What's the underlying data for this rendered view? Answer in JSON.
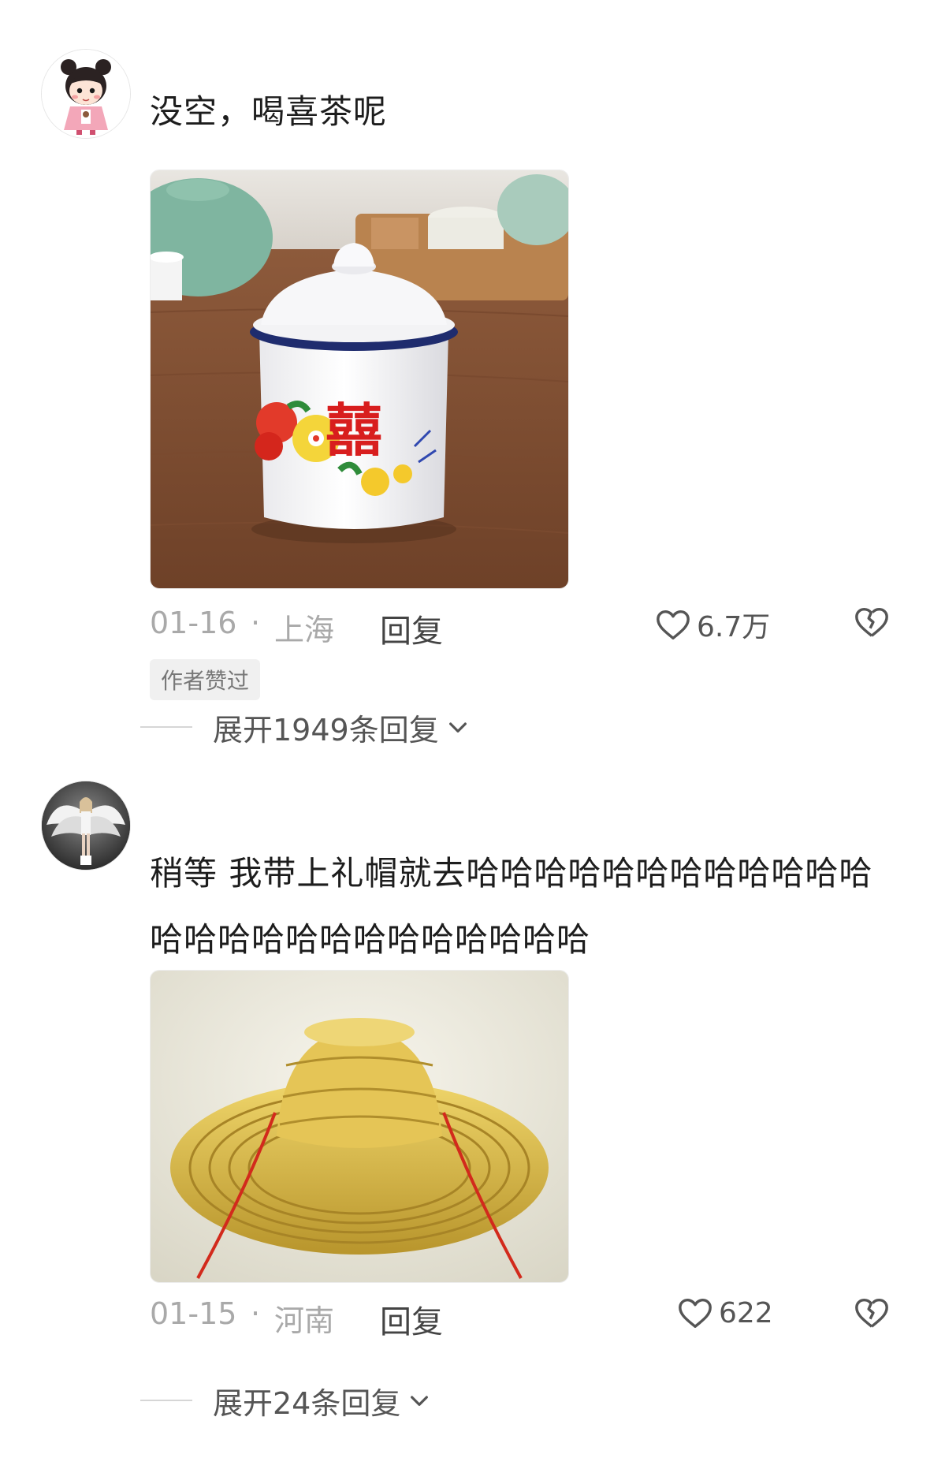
{
  "comments": [
    {
      "text": "没空，喝喜茶呢",
      "date": "01-16",
      "separator": "·",
      "location": "上海",
      "reply_label": "回复",
      "likes": "6.7万",
      "author_tag": "作者赞过",
      "expand_label": "展开1949条回复"
    },
    {
      "text": "稍等 我带上礼帽就去哈哈哈哈哈哈哈哈哈哈哈哈哈哈哈哈哈哈哈哈哈哈哈哈哈",
      "date": "01-15",
      "separator": "·",
      "location": "河南",
      "reply_label": "回复",
      "likes": "622",
      "expand_label": "展开24条回复"
    }
  ],
  "icons": {
    "like": "heart-outline-icon",
    "dislike": "broken-heart-icon",
    "expand": "chevron-down-icon"
  },
  "colors": {
    "meta_gray": "#a9a9a9",
    "text_dark": "#1d1d1d",
    "tag_bg": "#f0f0f0"
  }
}
